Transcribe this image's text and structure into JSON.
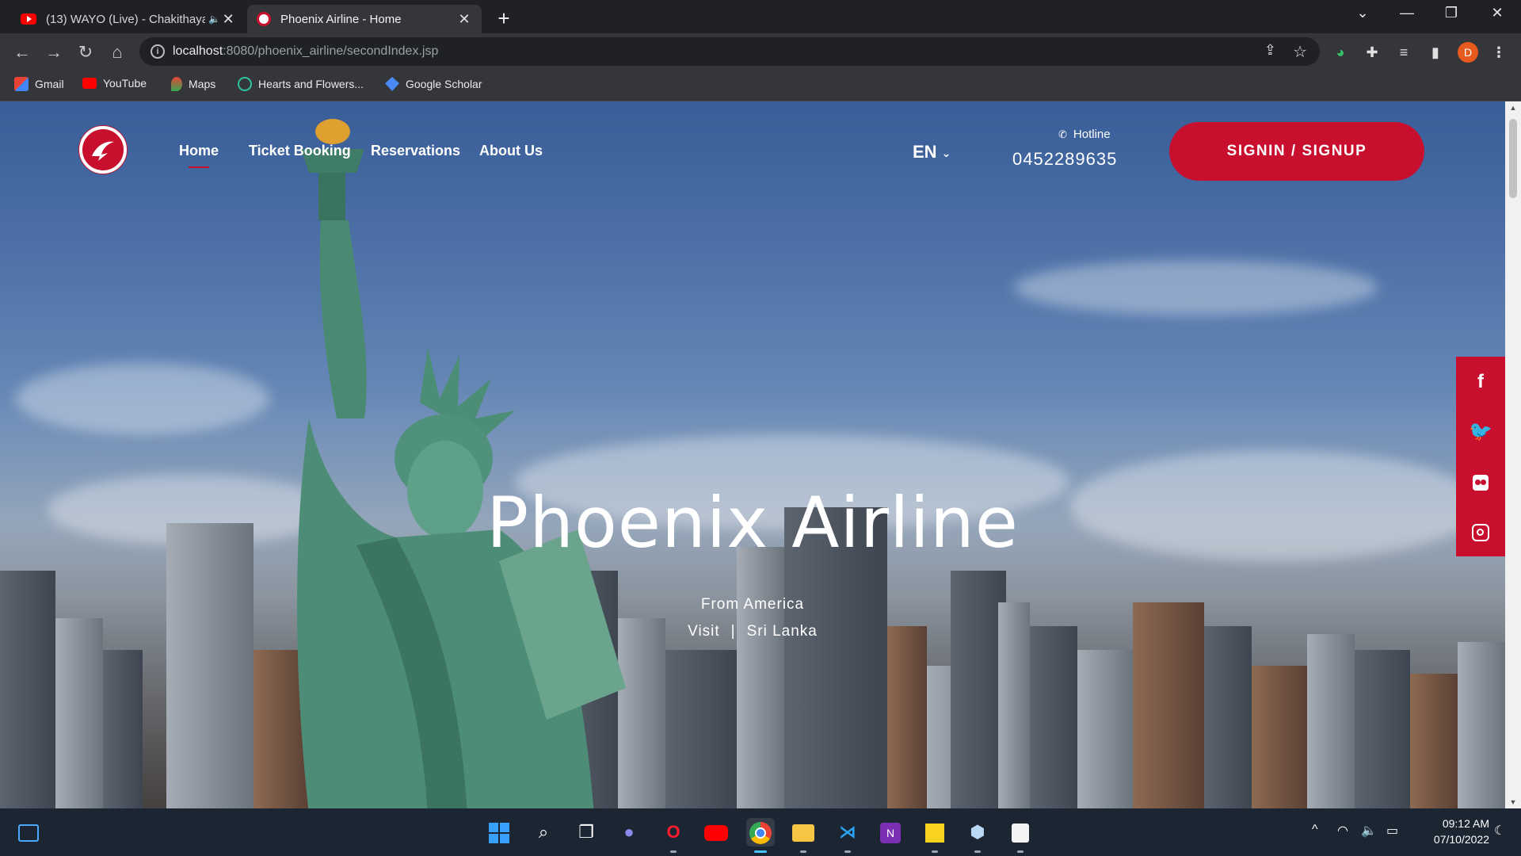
{
  "browser": {
    "tabs": [
      {
        "title": "(13) WAYO (Live) - Chakithaya",
        "active": false,
        "favicon": "youtube-icon"
      },
      {
        "title": "Phoenix Airline - Home",
        "active": true,
        "favicon": "phoenix-logo-icon"
      }
    ],
    "url_host": "localhost",
    "url_rest": ":8080/phoenix_airline/secondIndex.jsp",
    "profile_initial": "D",
    "bookmarks": [
      {
        "label": "Gmail",
        "icon": "gmail-icon"
      },
      {
        "label": "YouTube",
        "icon": "youtube-icon"
      },
      {
        "label": "Maps",
        "icon": "maps-icon"
      },
      {
        "label": "Hearts and Flowers...",
        "icon": "hearts-flowers-icon"
      },
      {
        "label": "Google Scholar",
        "icon": "google-scholar-icon"
      }
    ]
  },
  "site": {
    "nav": [
      {
        "label": "Home",
        "active": true
      },
      {
        "label": "Ticket Booking",
        "active": false
      },
      {
        "label": "Reservations",
        "active": false
      },
      {
        "label": "About Us",
        "active": false
      }
    ],
    "language": "EN",
    "hotline_label": "Hotline",
    "hotline_number": "0452289635",
    "signin_label": "SIGNIN / SIGNUP",
    "hero": {
      "title": "Phoenix Airline",
      "line1": "From America",
      "visit": "Visit",
      "separator": "|",
      "destination": "Sri Lanka"
    },
    "social": [
      "facebook-icon",
      "twitter-icon",
      "flickr-icon",
      "instagram-icon"
    ],
    "colors": {
      "brand": "#c8102e"
    }
  },
  "taskbar": {
    "time": "09:12 AM",
    "date": "07/10/2022"
  }
}
